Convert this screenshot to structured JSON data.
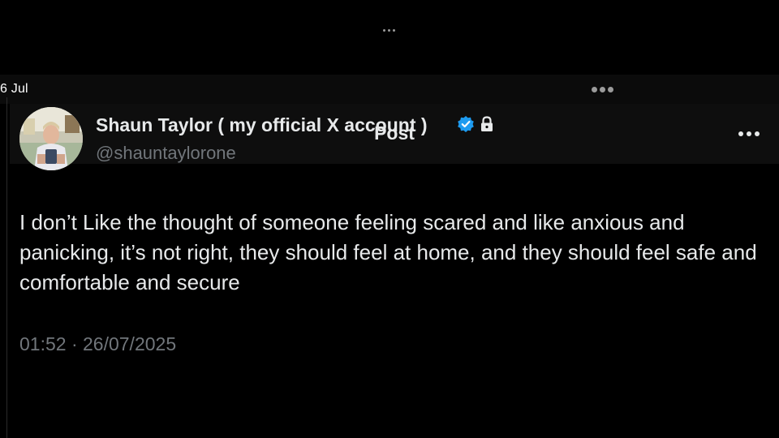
{
  "status_bar": {
    "date": "6 Jul"
  },
  "header": {
    "title": "Post",
    "back_icon": "arrow-left-icon",
    "more_icon": "more-horizontal-icon"
  },
  "post": {
    "author_name": "Shaun Taylor ( my official X account )",
    "author_handle": "@shauntaylorone",
    "verified": true,
    "protected": true,
    "text": "I don’t Like the thought of someone feeling scared and like anxious and panicking, it’s not right, they should feel at home, and they should feel safe and comfortable and secure",
    "timestamp": "01:52 · 26/07/2025"
  },
  "colors": {
    "background": "#000000",
    "text_primary": "#e7e9ea",
    "text_secondary": "#71767b",
    "verified_blue": "#1d9bf0"
  }
}
